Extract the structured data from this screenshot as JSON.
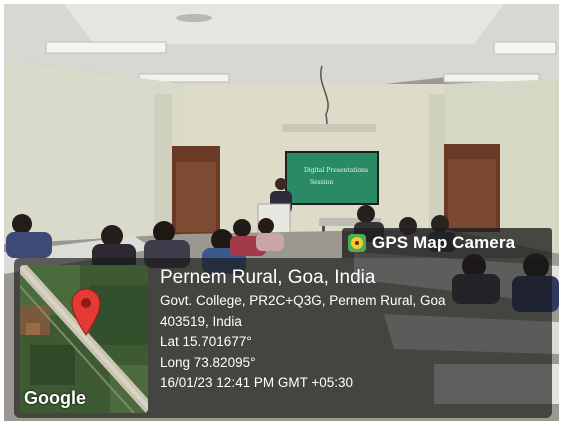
{
  "watermark": {
    "app_name": "GPS Map Camera",
    "icon": "gps-map-camera-icon"
  },
  "location": {
    "title": "Pernem Rural, Goa, India",
    "address_line_1": "Govt. College, PR2C+Q3G, Pernem Rural, Goa",
    "address_line_2": "403519, India",
    "latitude": "Lat 15.701677°",
    "longitude": "Long 73.82095°",
    "timestamp": "16/01/23 12:41 PM GMT +05:30"
  },
  "map": {
    "provider_logo": "Google",
    "pin_icon": "map-pin-icon"
  },
  "board_text": {
    "line_1": "Digital Presentations",
    "line_2": "Session"
  }
}
